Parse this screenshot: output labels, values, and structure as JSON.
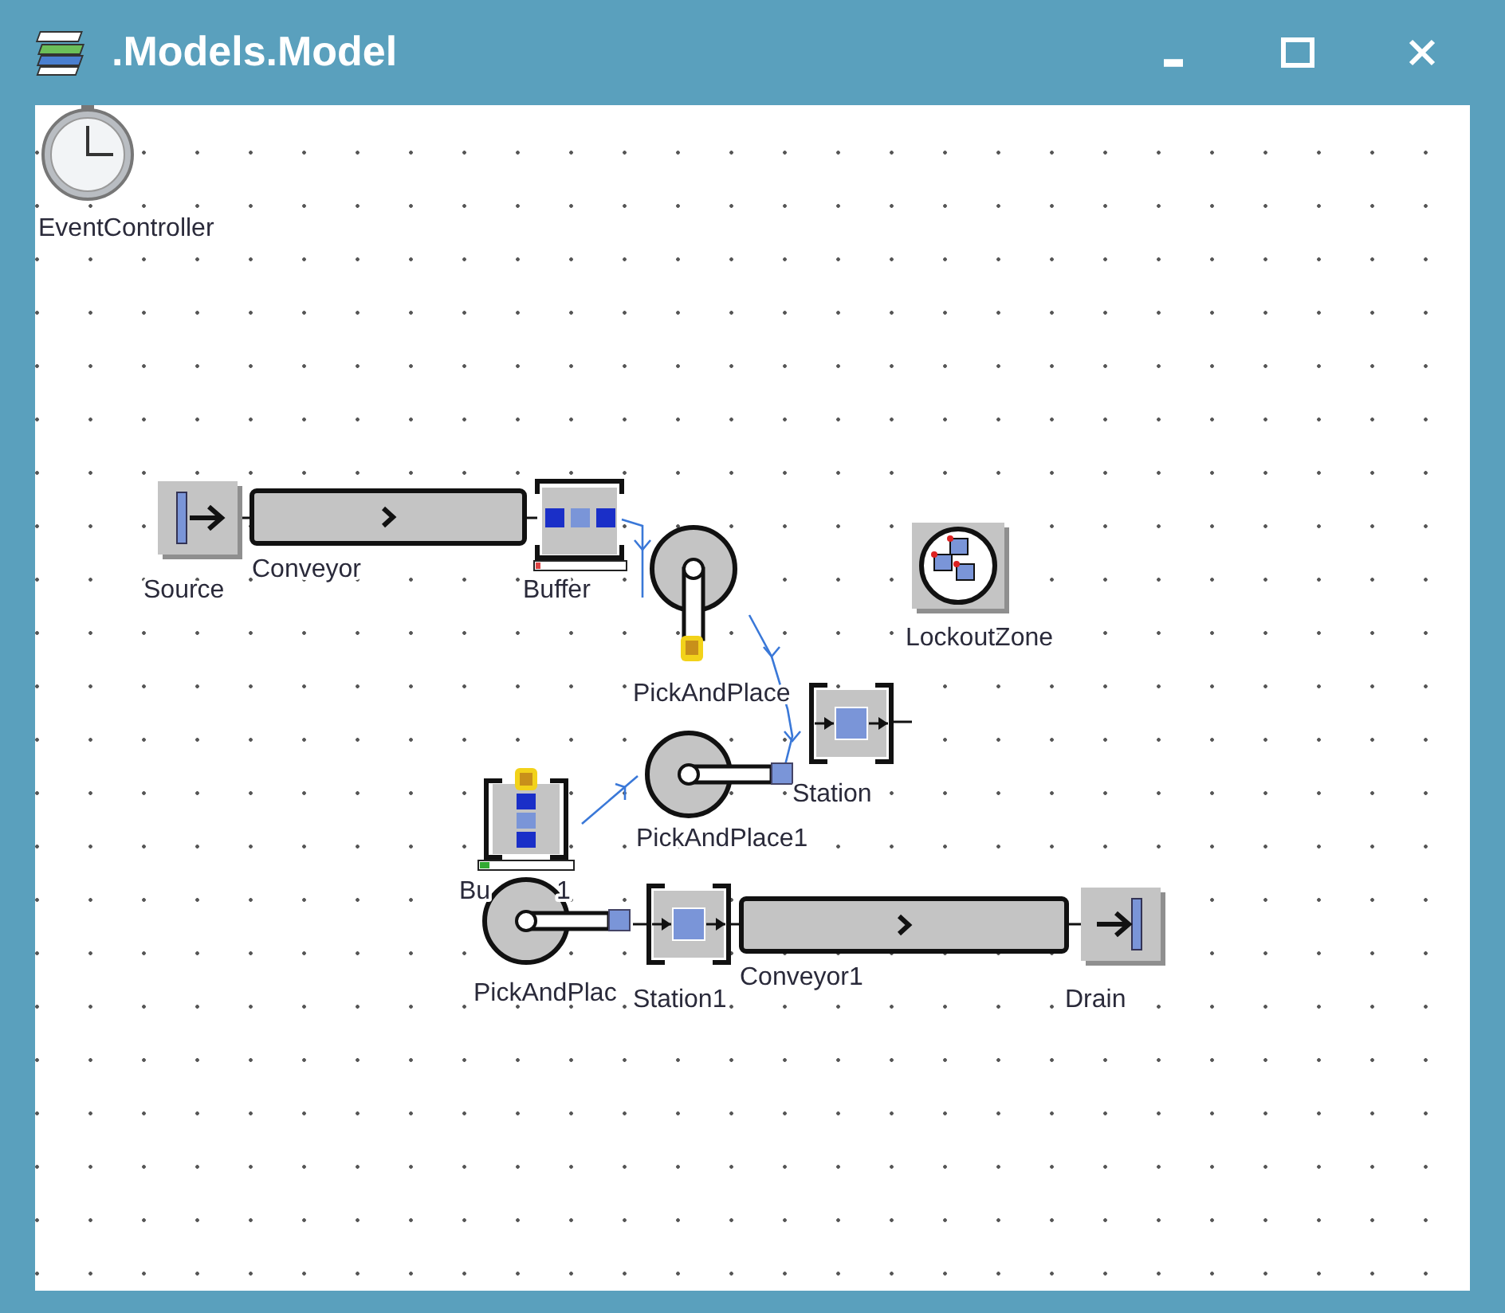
{
  "window": {
    "title": ".Models.Model"
  },
  "nodes": [
    {
      "kind": "clock",
      "label": "EventController"
    },
    {
      "kind": "source",
      "label": "Source"
    },
    {
      "kind": "conveyor",
      "label": "Conveyor"
    },
    {
      "kind": "buffer",
      "label": "Buffer"
    },
    {
      "kind": "robot",
      "label": "PickAndPlace"
    },
    {
      "kind": "lockout",
      "label": "LockoutZone"
    },
    {
      "kind": "station",
      "label": "Station"
    },
    {
      "kind": "robot",
      "label": "PickAndPlace1"
    },
    {
      "kind": "buffer",
      "label": "Bu",
      "label_tail": "1"
    },
    {
      "kind": "robot",
      "label": "PickAndPlac"
    },
    {
      "kind": "station",
      "label": "Station1"
    },
    {
      "kind": "conveyor",
      "label": "Conveyor1"
    },
    {
      "kind": "drain",
      "label": "Drain"
    }
  ]
}
